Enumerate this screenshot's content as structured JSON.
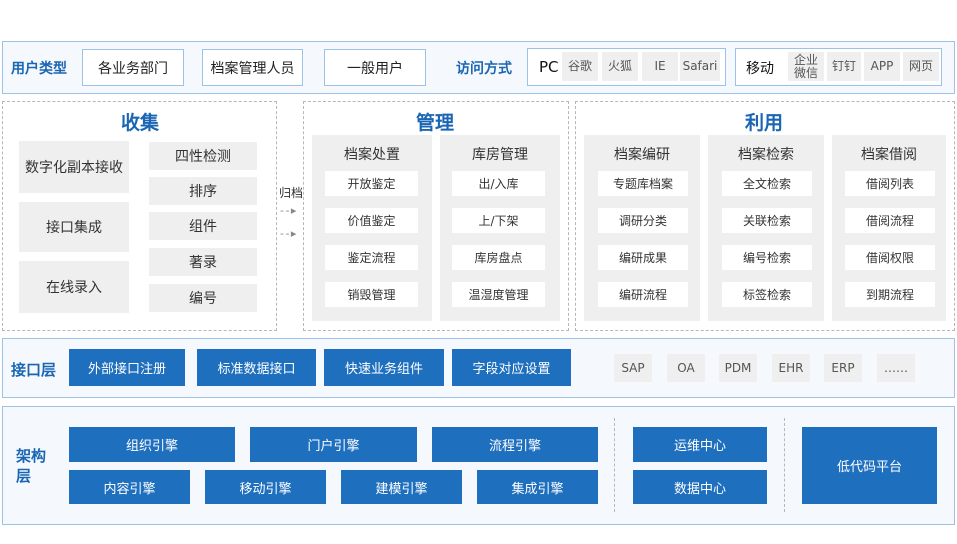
{
  "top": {
    "user_type_label": "用户类型",
    "user_types": [
      "各业务部门",
      "档案管理人员",
      "一般用户"
    ],
    "access_label": "访问方式",
    "pc": {
      "label": "PC",
      "items": [
        "谷歌",
        "火狐",
        "IE",
        "Safari"
      ]
    },
    "mobile": {
      "label": "移动",
      "items": [
        "企业\n微信",
        "钉钉",
        "APP",
        "网页"
      ]
    }
  },
  "collect": {
    "title": "收集",
    "left": [
      "数字化副本接收",
      "接口集成",
      "在线录入"
    ],
    "right": [
      "四性检测",
      "排序",
      "组件",
      "著录",
      "编号"
    ]
  },
  "archive_label": "归档",
  "manage": {
    "title": "管理",
    "columns": [
      {
        "title": "档案处置",
        "items": [
          "开放鉴定",
          "价值鉴定",
          "鉴定流程",
          "销毁管理"
        ]
      },
      {
        "title": "库房管理",
        "items": [
          "出/入库",
          "上/下架",
          "库房盘点",
          "温湿度管理"
        ]
      }
    ]
  },
  "use": {
    "title": "利用",
    "columns": [
      {
        "title": "档案编研",
        "items": [
          "专题库档案",
          "调研分类",
          "编研成果",
          "编研流程"
        ]
      },
      {
        "title": "档案检索",
        "items": [
          "全文检索",
          "关联检索",
          "编号检索",
          "标签检索"
        ]
      },
      {
        "title": "档案借阅",
        "items": [
          "借阅列表",
          "借阅流程",
          "借阅权限",
          "到期流程"
        ]
      }
    ]
  },
  "interface": {
    "label": "接口层",
    "buttons": [
      "外部接口注册",
      "标准数据接口",
      "快速业务组件",
      "字段对应设置"
    ],
    "systems": [
      "SAP",
      "OA",
      "PDM",
      "EHR",
      "ERP",
      "……"
    ]
  },
  "arch": {
    "label": "架构层",
    "row1": [
      "组织引擎",
      "门户引擎",
      "流程引擎"
    ],
    "row2": [
      "内容引擎",
      "移动引擎",
      "建模引擎",
      "集成引擎"
    ],
    "centers": [
      "运维中心",
      "数据中心"
    ],
    "platform": "低代码平台"
  },
  "colors": {
    "accent": "#1a66b3",
    "block": "#1f6fbf",
    "border": "#9cc3e6"
  }
}
